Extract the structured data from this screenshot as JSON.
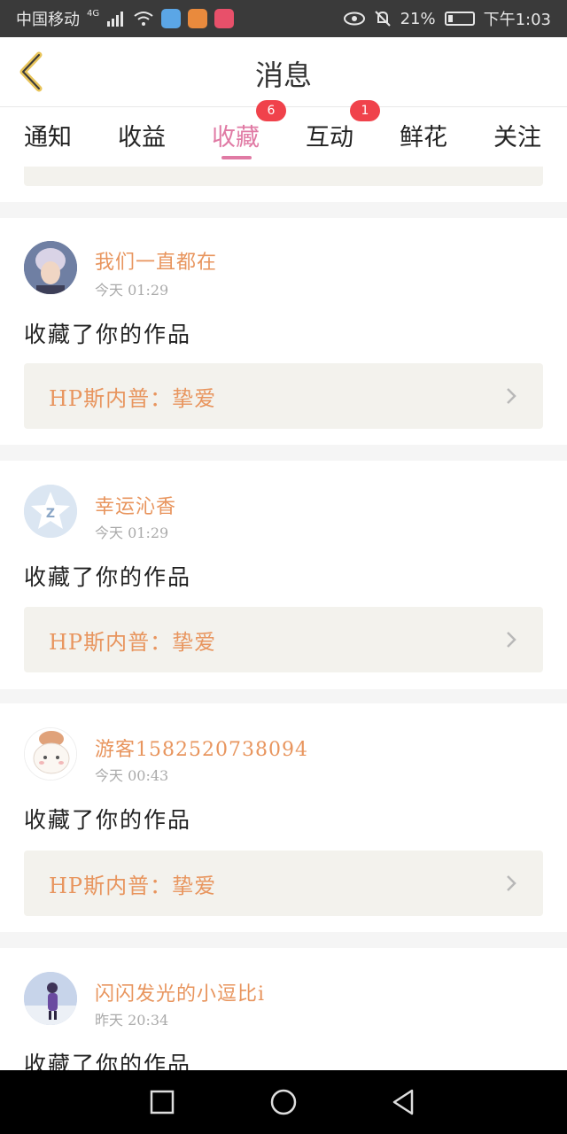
{
  "status_bar": {
    "carrier": "中国移动",
    "network": "4G",
    "battery_percent": "21%",
    "battery_level": 0.21,
    "time": "下午1:03",
    "icons": [
      "signal-icon",
      "wifi-icon",
      "app-icon",
      "app-icon",
      "app-icon",
      "eye-icon",
      "bell-mute-icon",
      "battery-icon"
    ]
  },
  "header": {
    "title": "消息",
    "back_icon": "chevron-left-icon"
  },
  "tabs": [
    {
      "label": "通知",
      "badge": ""
    },
    {
      "label": "收益",
      "badge": ""
    },
    {
      "label": "收藏",
      "badge": "6",
      "active": true
    },
    {
      "label": "互动",
      "badge": "1"
    },
    {
      "label": "鲜花",
      "badge": ""
    },
    {
      "label": "关注",
      "badge": ""
    }
  ],
  "messages": [
    {
      "user": "我们一直都在",
      "time": "今天 01:29",
      "action": "收藏了你的作品",
      "work": "HP斯内普：挚爱"
    },
    {
      "user": "幸运沁香",
      "time": "今天 01:29",
      "action": "收藏了你的作品",
      "work": "HP斯内普：挚爱"
    },
    {
      "user": "游客1582520738094",
      "time": "今天 00:43",
      "action": "收藏了你的作品",
      "work": "HP斯内普：挚爱"
    },
    {
      "user": "闪闪发光的小逗比i",
      "time": "昨天 20:34",
      "action": "收藏了你的作品",
      "work": ""
    }
  ],
  "colors": {
    "accent": "#e07aa4",
    "name": "#e8955e",
    "badge": "#f0424b"
  },
  "nav_bar": {
    "icons": [
      "square-icon",
      "circle-icon",
      "back-triangle-icon"
    ]
  }
}
